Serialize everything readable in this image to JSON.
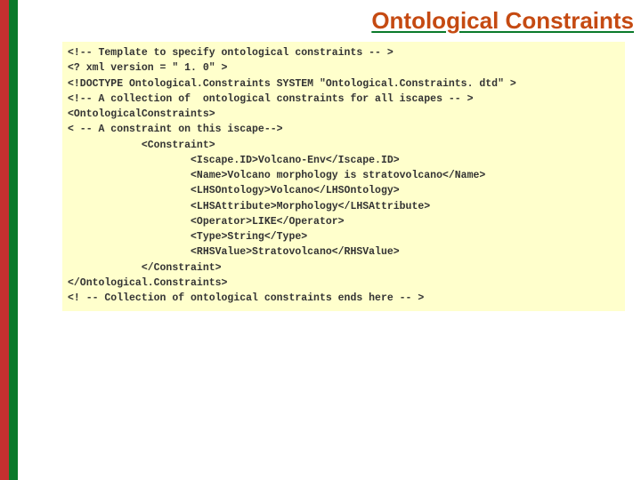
{
  "title": "Ontological Constraints",
  "code": {
    "l1": "<!-- Template to specify ontological constraints -- >",
    "l2": "<? xml version = \" 1. 0\" >",
    "l3": "<!DOCTYPE Ontological.Constraints SYSTEM \"Ontological.Constraints. dtd\" >",
    "l4": "<!-- A collection of  ontological constraints for all iscapes -- >",
    "l5": "<OntologicalConstraints>",
    "l6": "< -- A constraint on this iscape-->",
    "l7": "            <Constraint>",
    "l8": "                    <Iscape.ID>Volcano-Env</Iscape.ID>",
    "l9": "                    <Name>Volcano morphology is stratovolcano</Name>",
    "l10": "                    <LHSOntology>Volcano</LHSOntology>",
    "l11": "                    <LHSAttribute>Morphology</LHSAttribute>",
    "l12": "                    <Operator>LIKE</Operator>",
    "l13": "                    <Type>String</Type>",
    "l14": "                    <RHSValue>Stratovolcano</RHSValue>",
    "l15": "            </Constraint>",
    "l16": "</Ontological.Constraints>",
    "l17": "<! -- Collection of ontological constraints ends here -- >"
  }
}
